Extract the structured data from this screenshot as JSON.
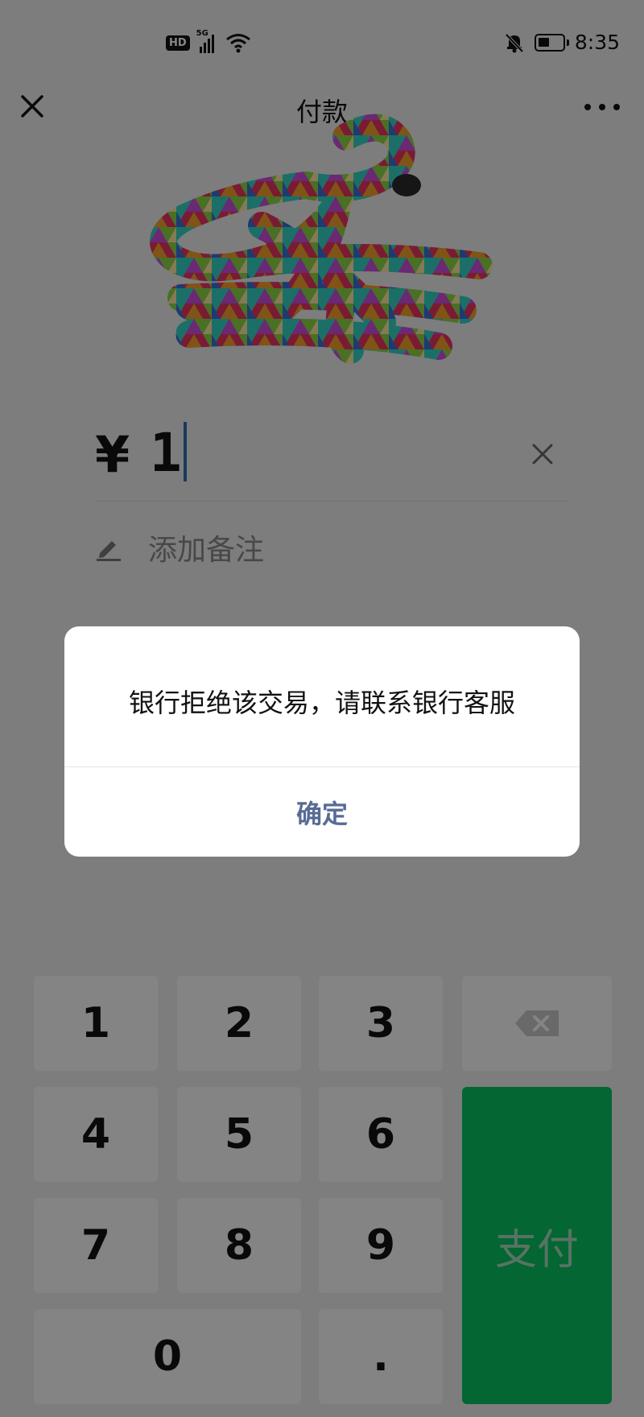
{
  "status_bar": {
    "hd_label": "HD",
    "network_label": "5G",
    "time": "8:35",
    "icons": [
      "hd-icon",
      "signal-5g-icon",
      "wifi-icon",
      "mute-bell-icon",
      "battery-icon"
    ]
  },
  "nav": {
    "title": "付款",
    "close_icon": "close-icon",
    "more_icon": "more-dots-icon"
  },
  "payment": {
    "currency_symbol": "¥",
    "amount": "1",
    "clear_icon": "clear-x-icon",
    "note_icon": "pencil-icon",
    "note_placeholder": "添加备注"
  },
  "keypad": {
    "digit_keys": [
      "1",
      "2",
      "3",
      "4",
      "5",
      "6",
      "7",
      "8",
      "9",
      "0",
      "."
    ],
    "backspace_icon": "backspace-icon",
    "pay_label": "支付",
    "pay_color": "#07c160"
  },
  "dialog": {
    "message": "银行拒绝该交易，请联系银行客服",
    "confirm_label": "确定",
    "confirm_color": "#576b95"
  }
}
